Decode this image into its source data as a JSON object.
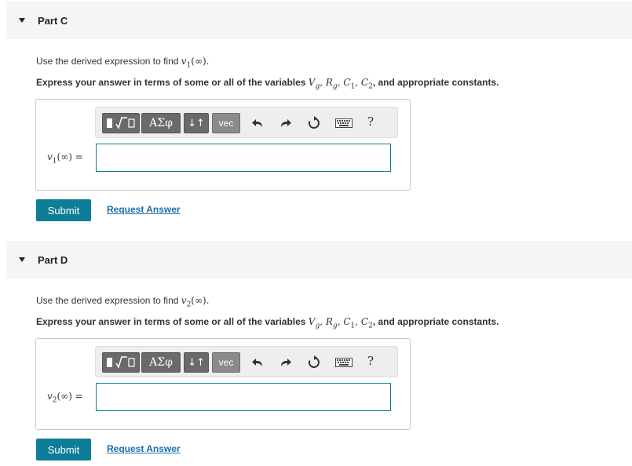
{
  "parts": [
    {
      "title": "Part C",
      "instruction_prefix": "Use the derived expression to find ",
      "instruction_var": "v",
      "instruction_sub": "1",
      "instruction_arg": "(∞).",
      "express_prefix": "Express your answer in terms of some or all of the variables ",
      "variables": [
        "V",
        "g",
        "R",
        "g",
        "C",
        "1",
        "C",
        "2"
      ],
      "express_suffix": ", and appropriate constants.",
      "answer_label_var": "v",
      "answer_label_sub": "1",
      "answer_label_rest": "(∞) =",
      "answer_value": "",
      "submit_label": "Submit",
      "request_label": "Request Answer"
    },
    {
      "title": "Part D",
      "instruction_prefix": "Use the derived expression to find ",
      "instruction_var": "v",
      "instruction_sub": "2",
      "instruction_arg": "(∞).",
      "express_prefix": "Express your answer in terms of some or all of the variables ",
      "variables": [
        "V",
        "g",
        "R",
        "g",
        "C",
        "1",
        "C",
        "2"
      ],
      "express_suffix": ", and appropriate constants.",
      "answer_label_var": "v",
      "answer_label_sub": "2",
      "answer_label_rest": "(∞) =",
      "answer_value": "",
      "submit_label": "Submit",
      "request_label": "Request Answer"
    }
  ],
  "toolbar": {
    "greek_label": "ΑΣφ",
    "vec_label": "vec",
    "help_label": "?",
    "icons": [
      "templates-icon",
      "greek-icon",
      "subscript-superscript-icon",
      "vec-icon",
      "undo-icon",
      "redo-icon",
      "reset-icon",
      "keyboard-icon",
      "help-icon"
    ]
  },
  "colors": {
    "accent": "#0f7d98",
    "link": "#1a6fb0",
    "header_bg": "#f5f5f5"
  }
}
